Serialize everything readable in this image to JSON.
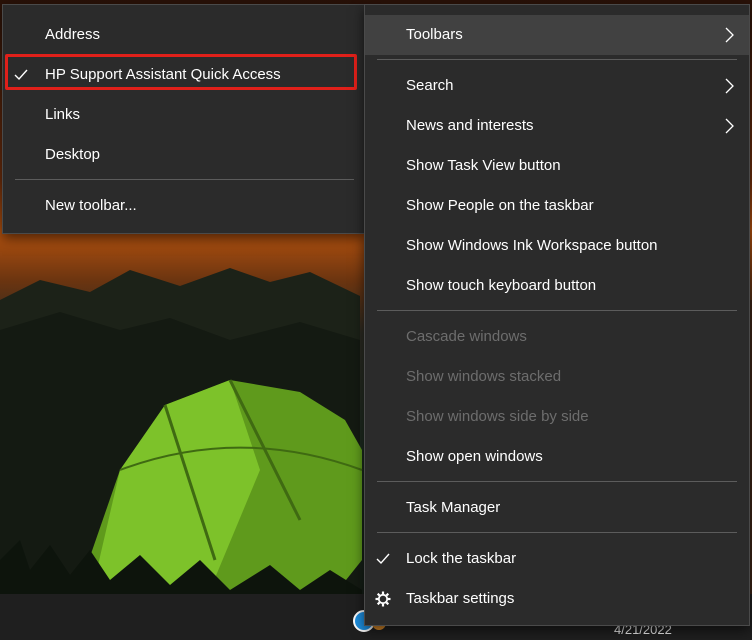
{
  "submenu": {
    "items": [
      {
        "label": "Address",
        "checked": false
      },
      {
        "label": "HP Support Assistant Quick Access",
        "checked": true
      },
      {
        "label": "Links",
        "checked": false
      },
      {
        "label": "Desktop",
        "checked": false
      },
      {
        "label": "New toolbar...",
        "checked": false
      }
    ]
  },
  "menu": {
    "items": [
      {
        "label": "Toolbars",
        "submenu": true,
        "enabled": true
      },
      {
        "label": "Search",
        "submenu": true,
        "enabled": true
      },
      {
        "label": "News and interests",
        "submenu": true,
        "enabled": true
      },
      {
        "label": "Show Task View button",
        "enabled": true
      },
      {
        "label": "Show People on the taskbar",
        "enabled": true
      },
      {
        "label": "Show Windows Ink Workspace button",
        "enabled": true
      },
      {
        "label": "Show touch keyboard button",
        "enabled": true
      },
      {
        "label": "Cascade windows",
        "enabled": false
      },
      {
        "label": "Show windows stacked",
        "enabled": false
      },
      {
        "label": "Show windows side by side",
        "enabled": false
      },
      {
        "label": "Show open windows",
        "enabled": true
      },
      {
        "label": "Task Manager",
        "enabled": true
      },
      {
        "label": "Lock the taskbar",
        "checked": true,
        "enabled": true
      },
      {
        "label": "Taskbar settings",
        "icon": "gear-icon",
        "enabled": true
      }
    ]
  },
  "taskbar": {
    "date": "4/21/2022"
  },
  "colors": {
    "menu_bg": "#2b2b2b",
    "hover_bg": "#414141",
    "text": "#ffffff",
    "disabled_text": "#6d6d6d",
    "highlight": "#e0201a"
  }
}
